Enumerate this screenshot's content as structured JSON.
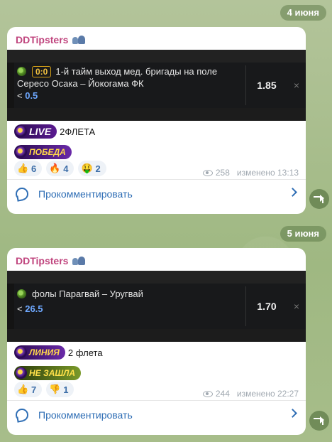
{
  "dates": [
    "4 июня",
    "5 июня"
  ],
  "posts": [
    {
      "sender": "DDTipsters",
      "card": {
        "score": "0:0",
        "title": "1-й тайм выход мед. бригады на поле",
        "match": "Сересо Осака – Йокогама ФК",
        "bet_prefix": "<",
        "bet_value": "0.5",
        "odds": "1.85",
        "close": "×"
      },
      "badge1": "LIVE",
      "text1": "2ФЛЕТА",
      "badge2": "ПОБЕДА",
      "reactions": [
        {
          "icon": "thumbs-up-icon",
          "glyph": "👍",
          "count": "6"
        },
        {
          "icon": "fire-icon",
          "glyph": "🔥",
          "count": "4"
        },
        {
          "icon": "money-face-icon",
          "glyph": "🤑",
          "count": "2"
        }
      ],
      "views": "258",
      "edited": "изменено 13:13",
      "comment": "Прокомментировать"
    },
    {
      "sender": "DDTipsters",
      "card": {
        "score": "",
        "title": "фолы Парагвай – Уругвай",
        "match": "",
        "bet_prefix": "<",
        "bet_value": "26.5",
        "odds": "1.70",
        "close": "×"
      },
      "badge1": "ЛИНИЯ",
      "text1": "2 флета",
      "badge2": "НЕ ЗАШЛА",
      "reactions": [
        {
          "icon": "thumbs-up-icon",
          "glyph": "👍",
          "count": "7"
        },
        {
          "icon": "thumbs-down-icon",
          "glyph": "👎",
          "count": "1"
        }
      ],
      "views": "244",
      "edited": "изменено 22:27",
      "comment": "Прокомментировать"
    }
  ],
  "colors": {
    "sender": "#c0457e",
    "link": "#2f6eb5",
    "odd_value": "#6ea8ff"
  }
}
